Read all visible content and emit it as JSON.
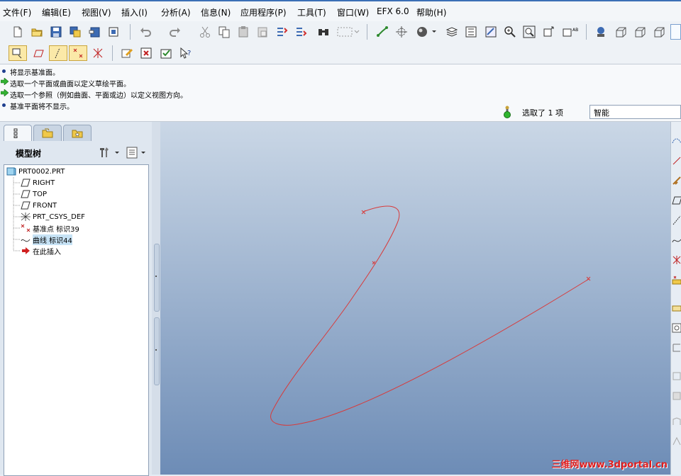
{
  "menu": [
    "文件(F)",
    "编辑(E)",
    "视图(V)",
    "插入(I)",
    "分析(A)",
    "信息(N)",
    "应用程序(P)",
    "工具(T)",
    "窗口(W)",
    "EFX 6.0",
    "帮助(H)"
  ],
  "messages": [
    {
      "type": "dot",
      "text": "将显示基准面。"
    },
    {
      "type": "arrow",
      "text": "选取一个平面或曲面以定义草绘平面。"
    },
    {
      "type": "arrow",
      "text": "选取一个参照（例如曲面、平面或边）以定义视图方向。"
    },
    {
      "type": "dot",
      "text": "基准平面将不显示。"
    }
  ],
  "status": {
    "selection": "选取了 1 项",
    "filter": "智能"
  },
  "model_tree": {
    "title": "模型树",
    "root": "PRT0002.PRT",
    "items": [
      "RIGHT",
      "TOP",
      "FRONT",
      "PRT_CSYS_DEF",
      "基准点 标识39",
      "曲线 标识44",
      "在此插入"
    ]
  },
  "watermark": "三维网www.3dportal.cn"
}
